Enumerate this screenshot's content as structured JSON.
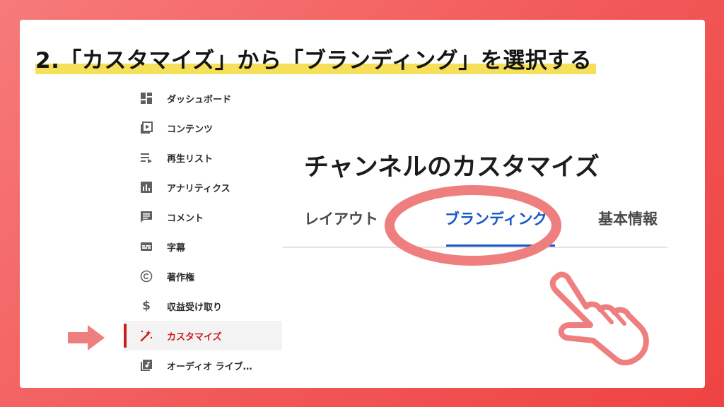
{
  "title": "2.「カスタマイズ」から「ブランディング」を選択する",
  "sidebar": {
    "items": [
      {
        "label": "ダッシュボード",
        "icon": "dashboard-icon"
      },
      {
        "label": "コンテンツ",
        "icon": "content-icon"
      },
      {
        "label": "再生リスト",
        "icon": "playlist-icon"
      },
      {
        "label": "アナリティクス",
        "icon": "analytics-icon"
      },
      {
        "label": "コメント",
        "icon": "comment-icon"
      },
      {
        "label": "字幕",
        "icon": "subtitles-icon"
      },
      {
        "label": "著作権",
        "icon": "copyright-icon"
      },
      {
        "label": "収益受け取り",
        "icon": "dollar-icon"
      },
      {
        "label": "カスタマイズ",
        "icon": "magic-wand-icon",
        "active": true
      },
      {
        "label": "オーディオ ライブ…",
        "icon": "audio-library-icon"
      }
    ]
  },
  "main": {
    "heading": "チャンネルのカスタマイズ",
    "tabs": [
      {
        "label": "レイアウト"
      },
      {
        "label": "ブランディング",
        "active": true
      },
      {
        "label": "基本情報"
      }
    ]
  },
  "colors": {
    "background": "#f25858",
    "highlight": "#f6e05a",
    "active_nav": "#cc1b1b",
    "active_tab": "#1659c4",
    "annotation": "#ef7f7f"
  }
}
